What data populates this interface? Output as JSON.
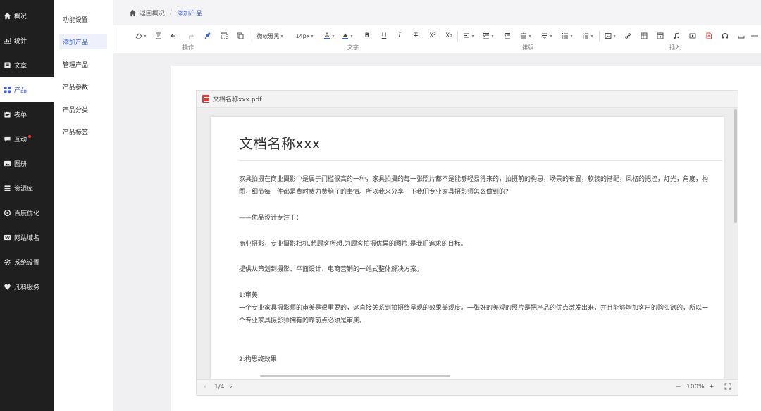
{
  "sidebar": {
    "items": [
      {
        "label": "概况",
        "icon": "home-icon"
      },
      {
        "label": "统计",
        "icon": "stats-icon"
      },
      {
        "label": "文章",
        "icon": "article-icon"
      },
      {
        "label": "产品",
        "icon": "product-icon",
        "active": true
      },
      {
        "label": "表单",
        "icon": "form-icon"
      },
      {
        "label": "互动",
        "icon": "chat-icon",
        "badge": true
      },
      {
        "label": "图册",
        "icon": "gallery-icon"
      },
      {
        "label": "资源库",
        "icon": "resource-icon"
      },
      {
        "label": "百度优化",
        "icon": "seo-icon"
      },
      {
        "label": "网站域名",
        "icon": "domain-icon"
      },
      {
        "label": "系统设置",
        "icon": "gear-icon"
      },
      {
        "label": "凡科服务",
        "icon": "heart-icon"
      }
    ]
  },
  "submenu": {
    "items": [
      {
        "label": "功能设置"
      },
      {
        "label": "添加产品",
        "active": true
      },
      {
        "label": "管理产品"
      },
      {
        "label": "产品参数"
      },
      {
        "label": "产品分类"
      },
      {
        "label": "产品标签"
      }
    ]
  },
  "breadcrumb": {
    "back": "返回概况",
    "separator": "/",
    "current": "添加产品"
  },
  "toolbar": {
    "font_family": "微软雅黑",
    "font_size": "14px",
    "groups": {
      "operate": "操作",
      "text": "文字",
      "layout": "排版",
      "insert": "插入"
    }
  },
  "viewer": {
    "file_name": "文档名称xxx.pdf",
    "page_indicator": "1/4",
    "zoom": "100%",
    "zoom_minus": "−",
    "zoom_plus": "+",
    "prev": "‹",
    "next": "›"
  },
  "document": {
    "title": "文档名称xxx",
    "paragraphs": [
      "家具拍摄在商业摄影中是属于门槛很高的一种，家具拍摄的每一张照片都不是能够轻易得来的，拍摄前的构思，场景的布置，软装的搭配，风格的把控，灯光，角度，构图，细节每一件都是费时费力费脑子的事情。所以我来分享一下我们专业家具摄影师怎么做到的?",
      "——优品设计专注于：",
      "商业摄影，专业摄影相机,想顾客所想,为顾客拍摄优异的图片,是我们追求的目标。",
      "提供从策划到摄影、平面设计、电商营销的一站式整体解决方案。",
      "1:审美",
      "一个专业家具摄影师的审美是很重要的，这直接关系到拍摄终呈现的效果美观度。一张好的美观的照片是把产品的优点激发出来，并且能够增加客户的购买欲的，所以一个专业家具摄影师拥有的靠前点必须是审美。",
      "2:构思终效果"
    ]
  },
  "colors": {
    "accent": "#3a5fd8",
    "sidebar_bg": "#1f1f1f",
    "badge": "#e53935"
  }
}
